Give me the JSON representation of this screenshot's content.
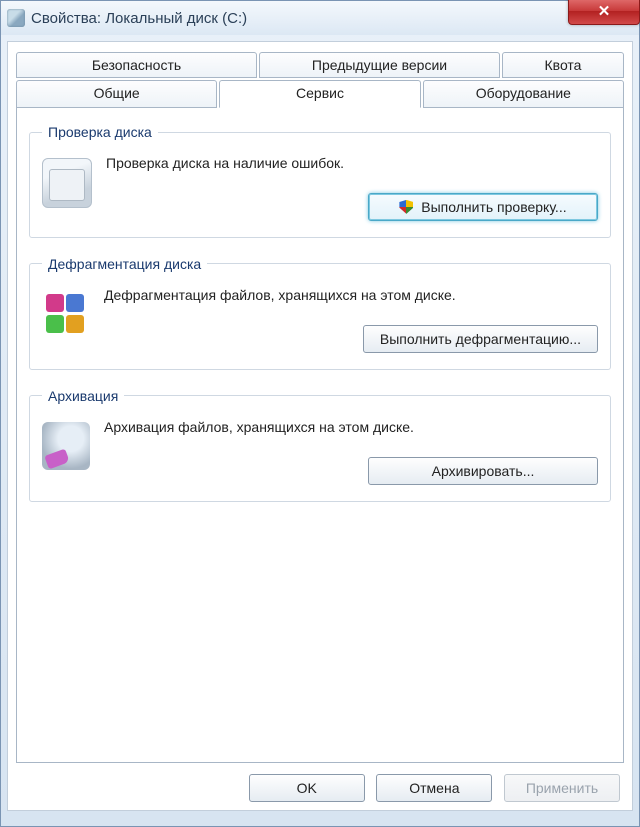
{
  "title": "Свойства: Локальный диск (C:)",
  "tabs_top": [
    "Безопасность",
    "Предыдущие версии",
    "Квота"
  ],
  "tabs_bottom": [
    "Общие",
    "Сервис",
    "Оборудование"
  ],
  "active_tab": "Сервис",
  "groups": {
    "check": {
      "legend": "Проверка диска",
      "desc": "Проверка диска на наличие ошибок.",
      "button": "Выполнить проверку..."
    },
    "defrag": {
      "legend": "Дефрагментация диска",
      "desc": "Дефрагментация файлов, хранящихся на этом диске.",
      "button": "Выполнить дефрагментацию..."
    },
    "backup": {
      "legend": "Архивация",
      "desc": "Архивация файлов, хранящихся на этом диске.",
      "button": "Архивировать..."
    }
  },
  "buttons": {
    "ok": "OK",
    "cancel": "Отмена",
    "apply": "Применить"
  }
}
